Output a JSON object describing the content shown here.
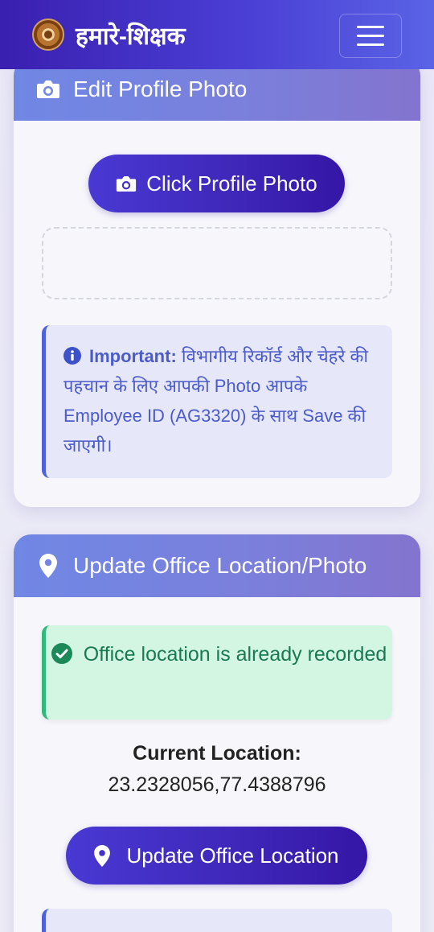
{
  "navbar": {
    "brand": "हमारे-शिक्षक",
    "logo_icon": "emblem-logo",
    "menu_icon": "hamburger-menu-icon"
  },
  "profile_card": {
    "header_icon": "camera-icon",
    "title": "Edit Profile Photo",
    "button_label": "Click Profile Photo",
    "info_label": "Important:",
    "info_text": " विभागीय रिकॉर्ड और चेहरे की पहचान के लिए आपकी Photo आपके Employee ID (AG3320) के साथ Save की जाएगी।"
  },
  "location_card": {
    "header_icon": "map-marker-icon",
    "title": "Update Office Location/Photo",
    "success_text": "Office location is already recorded",
    "current_label": "Current Location:",
    "current_value": "23.2328056,77.4388796",
    "button_label": "Update Office Location"
  },
  "colors": {
    "navbar_start": "#3a1fb0",
    "navbar_end": "#5a63e6",
    "header_start": "#7087e4",
    "button": "#3e26b8",
    "info_text": "#4b5bc9",
    "success_text": "#19794f"
  }
}
